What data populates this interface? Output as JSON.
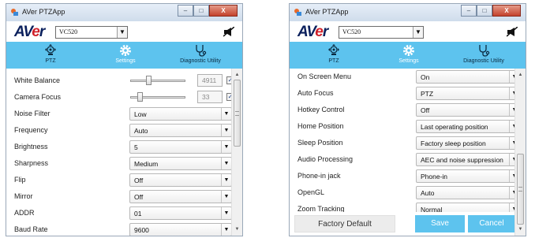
{
  "left_window": {
    "title": "AVer PTZApp",
    "title_buttons": {
      "minimize": "–",
      "maximize": "□",
      "close": "X"
    },
    "logo_text": "AVer",
    "model": "VC520",
    "nav": [
      {
        "label": "PTZ",
        "icon": "ptz-camera-icon"
      },
      {
        "label": "Settings",
        "icon": "gear-icon",
        "active": true
      },
      {
        "label": "Diagnostic Utility",
        "icon": "stethoscope-icon"
      }
    ],
    "slider_rows": [
      {
        "label": "White Balance",
        "value": "4911",
        "level_fraction": 0.32,
        "checked": true
      },
      {
        "label": "Camera Focus",
        "value": "33",
        "level_fraction": 0.15,
        "checked": true
      }
    ],
    "select_rows": [
      {
        "label": "Noise Filter",
        "value": "Low"
      },
      {
        "label": "Frequency",
        "value": "Auto"
      },
      {
        "label": "Brightness",
        "value": "5"
      },
      {
        "label": "Sharpness",
        "value": "Medium"
      },
      {
        "label": "Flip",
        "value": "Off"
      },
      {
        "label": "Mirror",
        "value": "Off"
      },
      {
        "label": "ADDR",
        "value": "01"
      },
      {
        "label": "Baud Rate",
        "value": "9600"
      }
    ],
    "scroll_position_fraction": 0.0
  },
  "right_window": {
    "title": "AVer PTZApp",
    "title_buttons": {
      "minimize": "–",
      "maximize": "□",
      "close": "X"
    },
    "logo_text": "AVer",
    "model": "VC520",
    "nav": [
      {
        "label": "PTZ",
        "icon": "ptz-camera-icon"
      },
      {
        "label": "Settings",
        "icon": "gear-icon",
        "active": true
      },
      {
        "label": "Diagnostic Utility",
        "icon": "stethoscope-icon"
      }
    ],
    "select_rows": [
      {
        "label": "On Screen Menu",
        "value": "On"
      },
      {
        "label": "Auto Focus",
        "value": "PTZ"
      },
      {
        "label": "Hotkey Control",
        "value": "Off"
      },
      {
        "label": "Home Position",
        "value": "Last operating position"
      },
      {
        "label": "Sleep Position",
        "value": "Factory sleep position"
      },
      {
        "label": "Audio Processing",
        "value": "AEC and noise suppression"
      },
      {
        "label": "Phone-in jack",
        "value": "Phone-in"
      },
      {
        "label": "OpenGL",
        "value": "Auto"
      },
      {
        "label": "Zoom Tracking",
        "value": "Normal"
      }
    ],
    "footer": {
      "factory_default": "Factory Default",
      "save": "Save",
      "cancel": "Cancel"
    },
    "scroll_position_fraction": 1.0
  },
  "colors": {
    "accent": "#5dc3ee",
    "logo_navy": "#0a1f5c",
    "logo_red": "#d0202a"
  }
}
